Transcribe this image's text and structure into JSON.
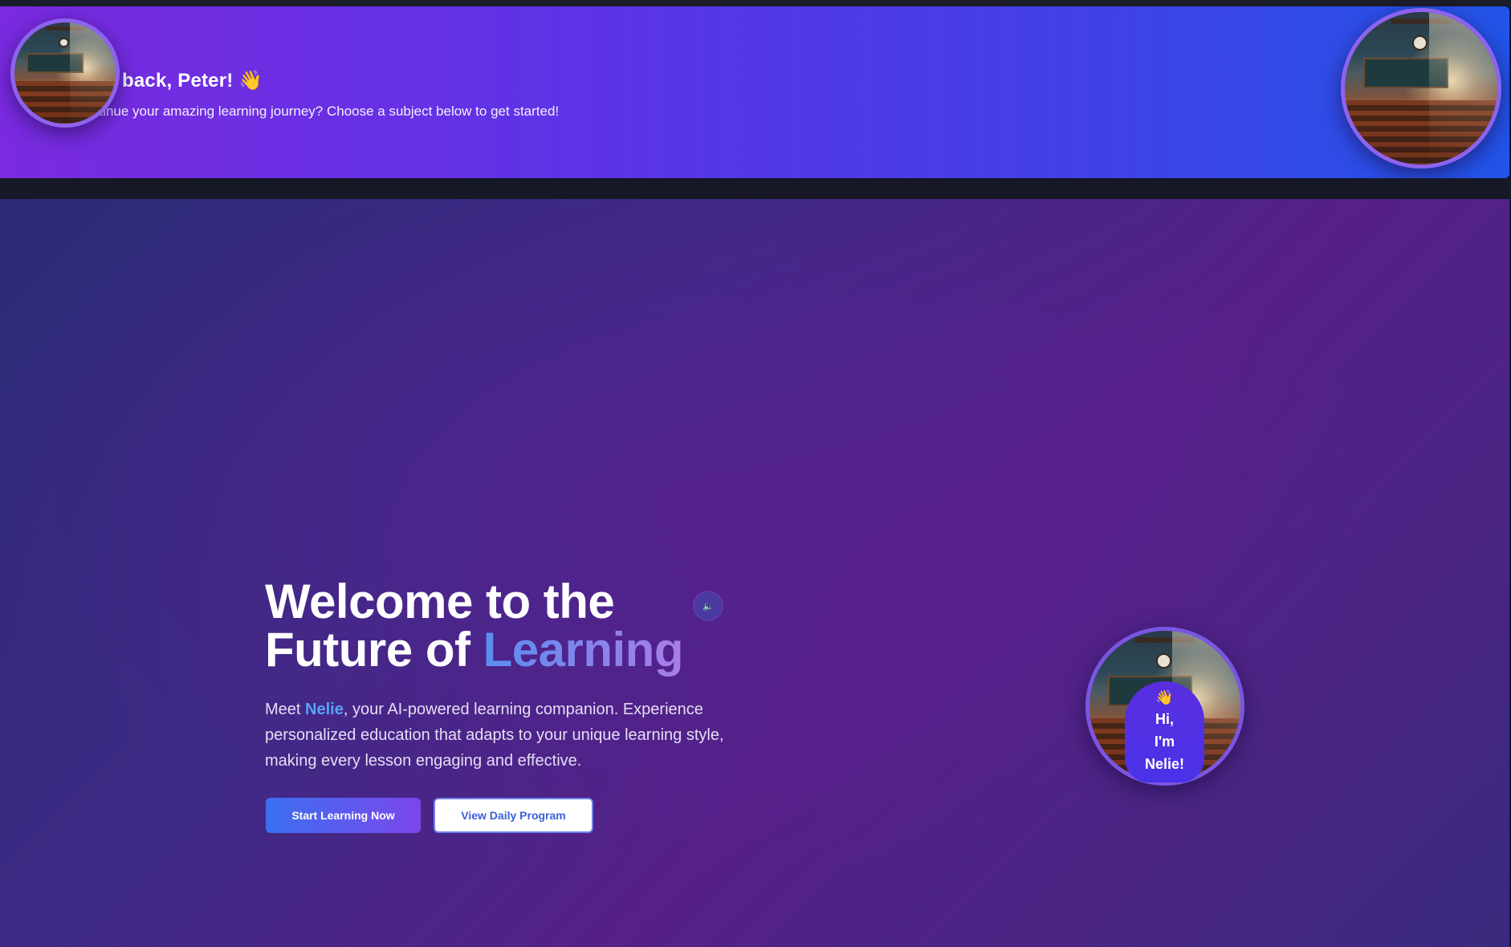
{
  "banner": {
    "greeting": "back, Peter! 👋",
    "subtitle": "ntinue your amazing learning journey? Choose a subject below to get started!"
  },
  "hero": {
    "title_line1": "Welcome to the",
    "title_line2_plain": "Future of ",
    "title_line2_accent": "Learning",
    "desc_before": "Meet ",
    "desc_name": "Nelie",
    "desc_after": ", your AI-powered learning companion. Experience personalized education that adapts to your unique learning style, making every lesson engaging and effective.",
    "sound_icon": "🔈",
    "primary_button": "Start Learning Now",
    "secondary_button": "View Daily Program"
  },
  "nelie": {
    "wave": "👋",
    "line1": "Hi,",
    "line2": "I'm",
    "line3": "Nelie!"
  },
  "colors": {
    "banner_start": "#7a2ae0",
    "banner_end": "#2254e8",
    "accent_blue": "#58a4f2",
    "primary_button_start": "#3b6ff0",
    "primary_button_end": "#7c47ea"
  },
  "icons": {
    "wave": "waving-hand-icon",
    "sound": "speaker-icon"
  }
}
